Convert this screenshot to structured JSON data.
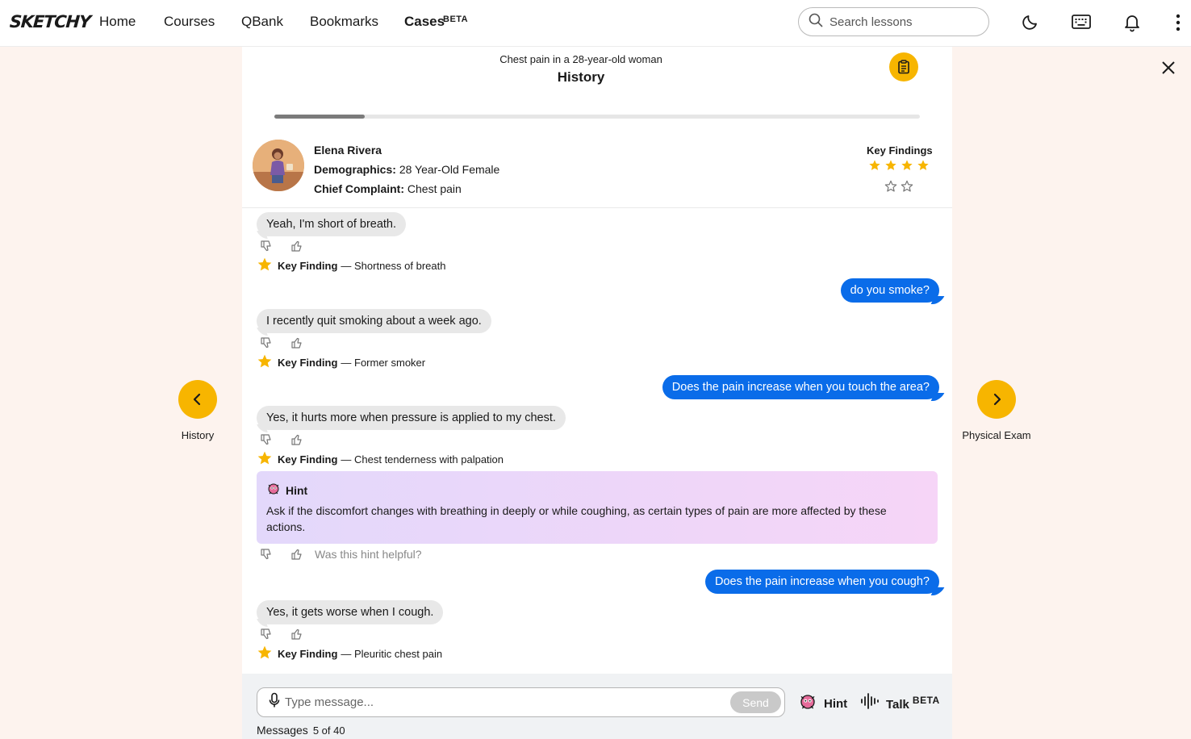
{
  "nav": {
    "logo": "SKETCHY",
    "links": [
      "Home",
      "Courses",
      "QBank",
      "Bookmarks"
    ],
    "active_link": "Cases",
    "active_badge": "BETA",
    "search_placeholder": "Search lessons"
  },
  "case": {
    "subtitle": "Chest pain in a 28-year-old woman",
    "section": "History",
    "progress": 0.14
  },
  "patient": {
    "name": "Elena Rivera",
    "demographics_label": "Demographics:",
    "demographics": "28 Year-Old Female",
    "complaint_label": "Chief Complaint:",
    "complaint": "Chest pain",
    "key_findings_label": "Key Findings",
    "stars_filled": 4,
    "stars_total": 6
  },
  "chat": {
    "key_finding_label": "Key Finding",
    "messages": [
      {
        "from": "patient",
        "text": "Yeah, I'm short of breath.",
        "finding": "— Shortness of breath"
      },
      {
        "from": "user",
        "text": "do you smoke?"
      },
      {
        "from": "patient",
        "text": "I recently quit smoking about a week ago.",
        "finding": "— Former smoker"
      },
      {
        "from": "user",
        "text": "Does the pain increase when you touch the area?"
      },
      {
        "from": "patient",
        "text": "Yes, it hurts more when pressure is applied to my chest.",
        "finding": "— Chest tenderness with palpation"
      },
      {
        "from": "user",
        "text": "Does the pain increase when you cough?"
      },
      {
        "from": "patient",
        "text": "Yes, it gets worse when I cough.",
        "finding": "— Pleuritic chest pain"
      }
    ],
    "hint": {
      "title": "Hint",
      "text": "Ask if the discomfort changes with breathing in deeply or while coughing, as certain types of pain are more affected by these actions.",
      "question": "Was this hint helpful?"
    }
  },
  "composer": {
    "placeholder": "Type message...",
    "send_label": "Send",
    "hint_label": "Hint",
    "talk_label": "Talk",
    "talk_badge": "BETA",
    "messages_label": "Messages",
    "messages_count": "5 of 40"
  },
  "side_nav": {
    "prev_label": "History",
    "next_label": "Physical Exam"
  },
  "colors": {
    "accent": "#f7b500",
    "user_bubble": "#0a6ce9",
    "patient_bubble": "#e8e8e8",
    "background": "#fdf3ee"
  }
}
